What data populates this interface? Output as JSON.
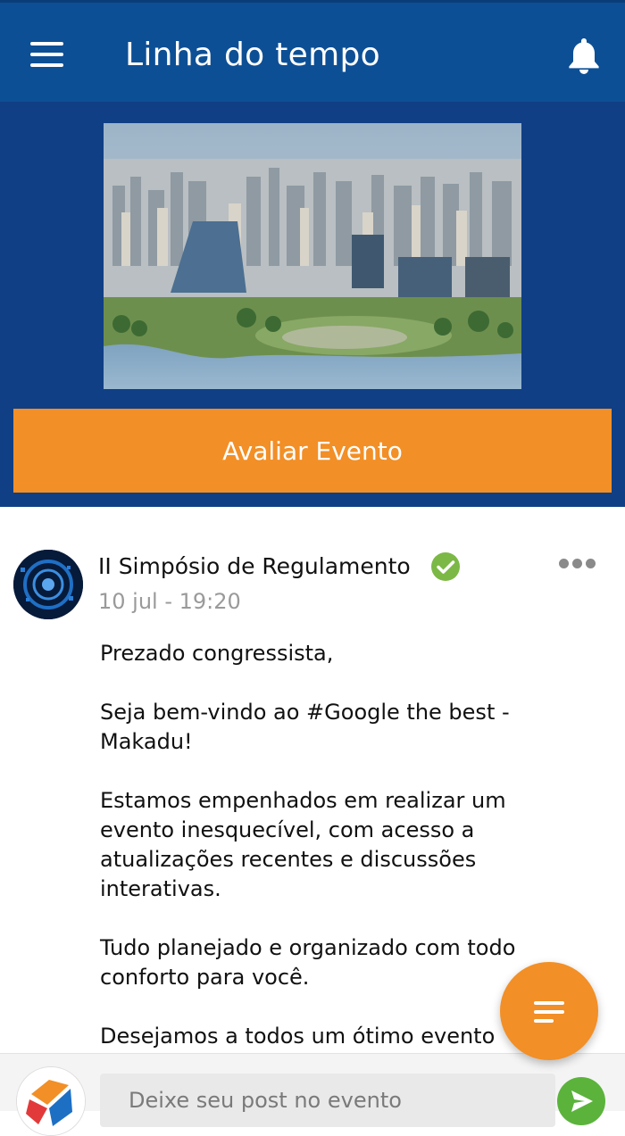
{
  "header": {
    "title": "Linha do tempo",
    "menu_icon": "hamburger-menu-icon",
    "bell_icon": "bell-icon",
    "background": "#0d4f95"
  },
  "hero": {
    "image": "city-skyline-photo",
    "rate_button_label": "Avaliar Evento",
    "rate_button_color": "#f28f26"
  },
  "post": {
    "author": "II Simpósio de Regulamento",
    "verified_icon": "verified-check-icon",
    "date": "10 jul - 19:20",
    "more_icon": "more-dots-icon",
    "paragraphs": [
      "Prezado congressista,",
      "Seja bem-vindo ao #Google the best - Makadu!",
      "Estamos empenhados em realizar um evento inesquecível, com acesso a atualizações recentes e discussões interativas.",
      "Tudo planejado e organizado com todo conforto para você.",
      "Desejamos a todos um ótimo evento"
    ]
  },
  "fab": {
    "icon": "filter-list-icon"
  },
  "composer": {
    "placeholder": "Deixe seu post no evento",
    "send_icon": "send-icon",
    "send_color": "#5bb33c"
  }
}
